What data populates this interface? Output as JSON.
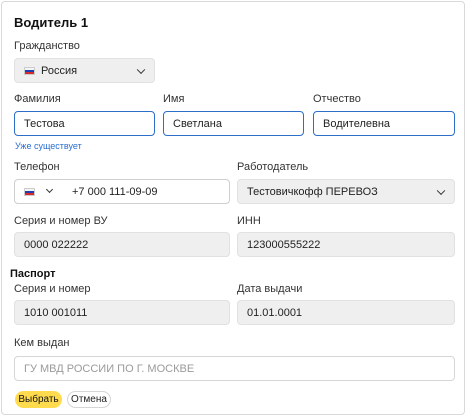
{
  "header": {
    "title": "Водитель 1"
  },
  "citizenship": {
    "label": "Гражданство",
    "value": "Россия"
  },
  "name": {
    "surname_label": "Фамилия",
    "surname_value": "Тестова",
    "surname_hint": "Уже существует",
    "first_label": "Имя",
    "first_value": "Светлана",
    "patronymic_label": "Отчество",
    "patronymic_value": "Водителевна"
  },
  "phone": {
    "label": "Телефон",
    "value": "+7 000 111-09-09"
  },
  "employer": {
    "label": "Работодатель",
    "value": "Тестовичкофф ПЕРЕВОЗ"
  },
  "license": {
    "label": "Серия и номер ВУ",
    "value": "0000 022222"
  },
  "inn": {
    "label": "ИНН",
    "value": "123000555222"
  },
  "passport": {
    "title": "Паспорт",
    "number_label": "Серия и номер",
    "number_value": "1010 001011",
    "date_label": "Дата выдачи",
    "date_value": "01.01.0001",
    "issuer_label": "Кем выдан",
    "issuer_placeholder": "ГУ МВД РОССИИ ПО Г. МОСКВЕ"
  },
  "actions": {
    "select_label": "Выбрать",
    "cancel_label": "Отмена"
  }
}
